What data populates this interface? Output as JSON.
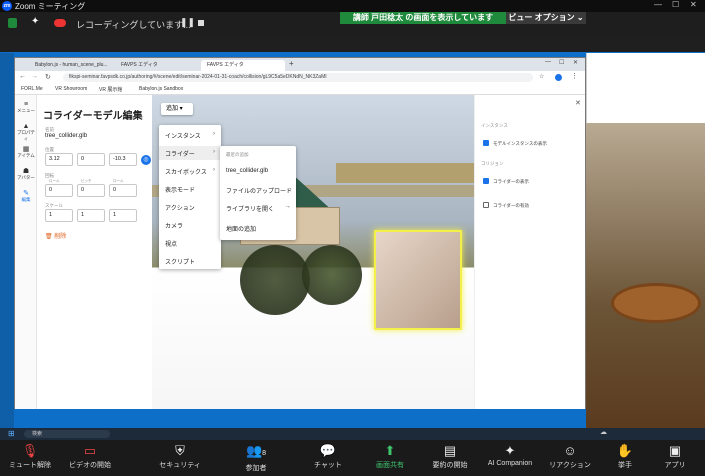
{
  "zoom": {
    "app_title": "Zoom ミーティング",
    "recording_text": "レコーディングしています...",
    "share_banner": "講師 戸田稔太 の画面を表示しています",
    "view_options": "ビュー オプション"
  },
  "browser": {
    "tabs": [
      "Babylon.js - human_scene_plu...",
      "FAVPS エディタ",
      "FAVPS エディタ"
    ],
    "url": "fikspi-seminar.favpsdk.co.jp/authoring/#/scene/edit/seminar-2024-01-31-coach/collision/gL9C5a5eDKNdN_NK3ZaMI",
    "bookmarks": [
      "FORL.Me",
      "VR Showroom",
      "VR 展示館",
      "Babylon.js Sandbox"
    ]
  },
  "leftnav": [
    {
      "icon": "menu-icon",
      "label": "メニュー"
    },
    {
      "icon": "property-icon",
      "label": "プロパティ"
    },
    {
      "icon": "item-icon",
      "label": "アイテム"
    },
    {
      "icon": "avatar-icon",
      "label": "アバター"
    },
    {
      "icon": "edit-icon",
      "label": "編集"
    }
  ],
  "panel": {
    "title": "コライダーモデル編集",
    "name_label": "名前",
    "name_value": "tree_collider.glb",
    "position_label": "位置",
    "pos_x": "3.12",
    "pos_y": "0",
    "pos_z": "-10.3",
    "rotation_label": "回転",
    "rot_x": "0",
    "rot_y": "0",
    "rot_z": "0",
    "rot_x_label": "ロール",
    "rot_y_label": "ピッチ",
    "rot_z_label": "ロール",
    "scale_label": "スケール",
    "sc_x": "1",
    "sc_y": "1",
    "sc_z": "1",
    "delete_label": "削除"
  },
  "add_button": "追加",
  "menu1": [
    "インスタンス",
    "コライダー",
    "スカイボックス",
    "表示モード",
    "アクション",
    "カメラ",
    "視点",
    "スクリプト"
  ],
  "menu2": {
    "header": "最近の追加",
    "recent": "tree_collider.glb",
    "upload": "ファイルのアップロード",
    "library": "ライブラリを開く",
    "map": "地面の追加"
  },
  "rightpanel": {
    "instance_header": "インスタンス",
    "show_model_instance": "モデルインスタンスの表示",
    "collision_header": "コリジョン",
    "show_collider": "コライダーの表示",
    "collider_enabled": "コライダーの有効"
  },
  "taskbar": {
    "search": "検索"
  },
  "zoombar": [
    {
      "icon": "mic-off-icon",
      "label": "ミュート解除"
    },
    {
      "icon": "video-off-icon",
      "label": "ビデオの開始"
    },
    {
      "icon": "shield-icon",
      "label": "セキュリティ"
    },
    {
      "icon": "participants-icon",
      "label": "参加者",
      "count": "8"
    },
    {
      "icon": "chat-icon",
      "label": "チャット"
    },
    {
      "icon": "share-icon",
      "label": "画面共有"
    },
    {
      "icon": "summary-icon",
      "label": "要約の開始"
    },
    {
      "icon": "ai-icon",
      "label": "AI Companion"
    },
    {
      "icon": "reaction-icon",
      "label": "リアクション"
    },
    {
      "icon": "hand-icon",
      "label": "挙手"
    },
    {
      "icon": "apps-icon",
      "label": "アプリ"
    }
  ],
  "colors": {
    "share_green": "#1f8a3c",
    "accent_blue": "#1a73e8",
    "collider_yellow": "#f3f04a"
  }
}
